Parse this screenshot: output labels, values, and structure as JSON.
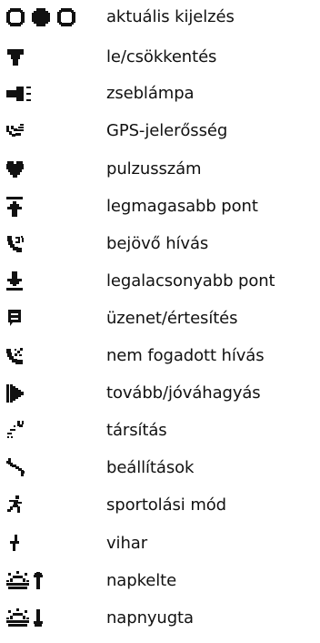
{
  "legend": {
    "items": [
      {
        "icon": "current-display-icons",
        "label": "aktuális kijelzés"
      },
      {
        "icon": "down-decrease-icon",
        "label": "le/csökkentés"
      },
      {
        "icon": "flashlight-icon",
        "label": "zseblámpa"
      },
      {
        "icon": "gps-signal-icon",
        "label": "GPS-jelerősség"
      },
      {
        "icon": "heart-icon",
        "label": "pulzusszám"
      },
      {
        "icon": "highest-point-icon",
        "label": "legmagasabb pont"
      },
      {
        "icon": "incoming-call-icon",
        "label": "bejövő hívás"
      },
      {
        "icon": "lowest-point-icon",
        "label": "legalacsonyabb pont"
      },
      {
        "icon": "message-icon",
        "label": "üzenet/értesítés"
      },
      {
        "icon": "missed-call-icon",
        "label": "nem fogadott hívás"
      },
      {
        "icon": "next-confirm-icon",
        "label": "tovább/jóváhagyás"
      },
      {
        "icon": "pairing-icon",
        "label": "társítás"
      },
      {
        "icon": "settings-icon",
        "label": "beállítások"
      },
      {
        "icon": "sport-mode-icon",
        "label": "sportolási mód"
      },
      {
        "icon": "storm-icon",
        "label": "vihar"
      },
      {
        "icon": "sunrise-icon",
        "label": "napkelte"
      },
      {
        "icon": "sunset-icon",
        "label": "napnyugta"
      }
    ]
  },
  "colors": {
    "icon": "#111111",
    "text": "#111111",
    "background": "#ffffff"
  }
}
